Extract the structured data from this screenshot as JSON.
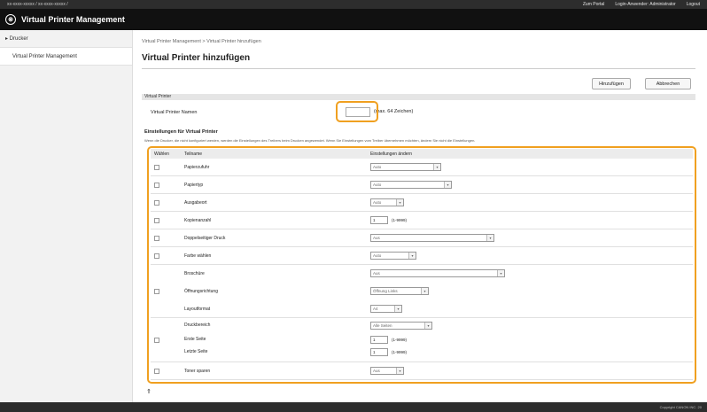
{
  "topbar": {
    "left": "xx-xxxx-xxxxx / xx-xxxx-xxxxx /",
    "links": [
      "Zum Portal",
      "Login-Anwender: Administrator",
      "Logout"
    ]
  },
  "app": {
    "title": "Virtual Printer Management",
    "logo": "⊗"
  },
  "sidebar": {
    "items": [
      {
        "label": "▸ Drucker"
      },
      {
        "label": "Virtual Printer Management"
      }
    ]
  },
  "breadcrumb": "Virtual Printer Management > Virtual Printer hinzufügen",
  "page_title": "Virtual Printer hinzufügen",
  "buttons": {
    "add": "Hinzufügen",
    "cancel": "Abbrechen"
  },
  "virtual_printer": {
    "section": "Virtual Printer",
    "name_label": "Virtual Printer Namen",
    "name_value": "",
    "hint": "(max. 64 Zeichen)"
  },
  "settings": {
    "section": "Einstellungen für Virtual Printer",
    "note": "Wenn die Drucker, die nicht konfiguriert werden, werden die Einstellungen des Treibers beim Drucken angewendet. Wenn Sie Einstellungen vom Treiber übernehmen möchten, ändern Sie nicht die Einstellungen.",
    "headers": {
      "col1": "Wählen",
      "col2": "Teilname",
      "col3": "Einstellungen ändern"
    },
    "rows": [
      {
        "label": "Papierzufuhr",
        "value": "Auto"
      },
      {
        "label": "Papiertyp",
        "value": "Auto"
      },
      {
        "label": "Ausgabeort",
        "value": "Auto"
      },
      {
        "label": "Kopienanzahl",
        "value": "1",
        "range": "(1-9999)"
      },
      {
        "label": "Doppelseitiger Druck",
        "value": "Aus"
      },
      {
        "label": "Farbe wählen",
        "value": "Auto"
      },
      {
        "label": "Broschüre",
        "value": "Aus"
      },
      {
        "label": "Öffnungsrichtung",
        "value": "Öffnung Links"
      },
      {
        "label": "Layoutformat",
        "value": "A4"
      },
      {
        "label": "Druckbereich",
        "value": "Alle Seiten"
      },
      {
        "label": "Erste Seite",
        "value": "1",
        "range": "(1-9999)"
      },
      {
        "label": "Letzte Seite",
        "value": "1",
        "range": "(1-9999)"
      },
      {
        "label": "Toner sparen",
        "value": "Aus"
      }
    ]
  },
  "back_icon": "⇑",
  "footer": "Copyright CANON INC. 20",
  "colors": {
    "highlight": "#f0a020",
    "titlebar": "#111111"
  }
}
